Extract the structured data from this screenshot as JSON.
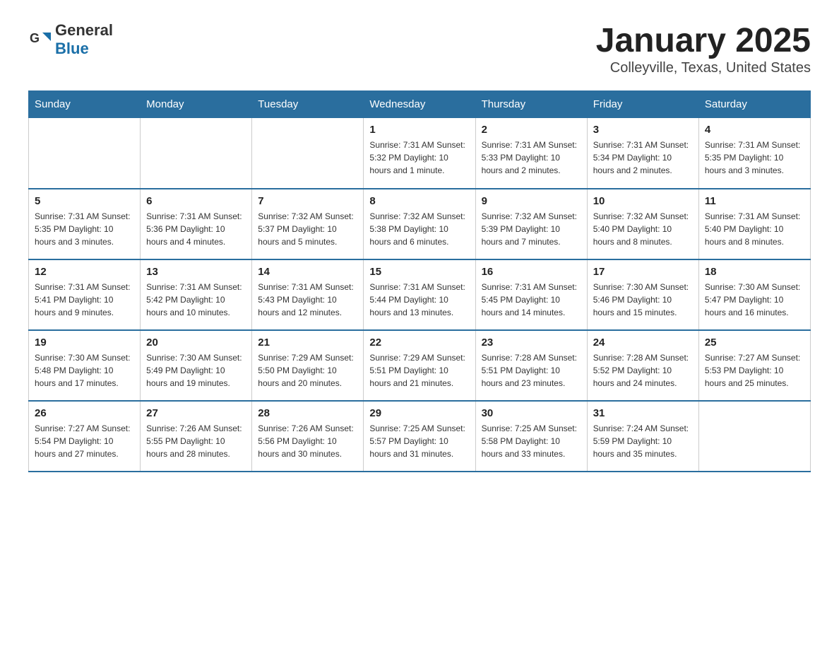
{
  "header": {
    "logo_text_general": "General",
    "logo_text_blue": "Blue",
    "title": "January 2025",
    "subtitle": "Colleyville, Texas, United States"
  },
  "days_of_week": [
    "Sunday",
    "Monday",
    "Tuesday",
    "Wednesday",
    "Thursday",
    "Friday",
    "Saturday"
  ],
  "weeks": [
    [
      {
        "day": "",
        "info": ""
      },
      {
        "day": "",
        "info": ""
      },
      {
        "day": "",
        "info": ""
      },
      {
        "day": "1",
        "info": "Sunrise: 7:31 AM\nSunset: 5:32 PM\nDaylight: 10 hours and 1 minute."
      },
      {
        "day": "2",
        "info": "Sunrise: 7:31 AM\nSunset: 5:33 PM\nDaylight: 10 hours and 2 minutes."
      },
      {
        "day": "3",
        "info": "Sunrise: 7:31 AM\nSunset: 5:34 PM\nDaylight: 10 hours and 2 minutes."
      },
      {
        "day": "4",
        "info": "Sunrise: 7:31 AM\nSunset: 5:35 PM\nDaylight: 10 hours and 3 minutes."
      }
    ],
    [
      {
        "day": "5",
        "info": "Sunrise: 7:31 AM\nSunset: 5:35 PM\nDaylight: 10 hours and 3 minutes."
      },
      {
        "day": "6",
        "info": "Sunrise: 7:31 AM\nSunset: 5:36 PM\nDaylight: 10 hours and 4 minutes."
      },
      {
        "day": "7",
        "info": "Sunrise: 7:32 AM\nSunset: 5:37 PM\nDaylight: 10 hours and 5 minutes."
      },
      {
        "day": "8",
        "info": "Sunrise: 7:32 AM\nSunset: 5:38 PM\nDaylight: 10 hours and 6 minutes."
      },
      {
        "day": "9",
        "info": "Sunrise: 7:32 AM\nSunset: 5:39 PM\nDaylight: 10 hours and 7 minutes."
      },
      {
        "day": "10",
        "info": "Sunrise: 7:32 AM\nSunset: 5:40 PM\nDaylight: 10 hours and 8 minutes."
      },
      {
        "day": "11",
        "info": "Sunrise: 7:31 AM\nSunset: 5:40 PM\nDaylight: 10 hours and 8 minutes."
      }
    ],
    [
      {
        "day": "12",
        "info": "Sunrise: 7:31 AM\nSunset: 5:41 PM\nDaylight: 10 hours and 9 minutes."
      },
      {
        "day": "13",
        "info": "Sunrise: 7:31 AM\nSunset: 5:42 PM\nDaylight: 10 hours and 10 minutes."
      },
      {
        "day": "14",
        "info": "Sunrise: 7:31 AM\nSunset: 5:43 PM\nDaylight: 10 hours and 12 minutes."
      },
      {
        "day": "15",
        "info": "Sunrise: 7:31 AM\nSunset: 5:44 PM\nDaylight: 10 hours and 13 minutes."
      },
      {
        "day": "16",
        "info": "Sunrise: 7:31 AM\nSunset: 5:45 PM\nDaylight: 10 hours and 14 minutes."
      },
      {
        "day": "17",
        "info": "Sunrise: 7:30 AM\nSunset: 5:46 PM\nDaylight: 10 hours and 15 minutes."
      },
      {
        "day": "18",
        "info": "Sunrise: 7:30 AM\nSunset: 5:47 PM\nDaylight: 10 hours and 16 minutes."
      }
    ],
    [
      {
        "day": "19",
        "info": "Sunrise: 7:30 AM\nSunset: 5:48 PM\nDaylight: 10 hours and 17 minutes."
      },
      {
        "day": "20",
        "info": "Sunrise: 7:30 AM\nSunset: 5:49 PM\nDaylight: 10 hours and 19 minutes."
      },
      {
        "day": "21",
        "info": "Sunrise: 7:29 AM\nSunset: 5:50 PM\nDaylight: 10 hours and 20 minutes."
      },
      {
        "day": "22",
        "info": "Sunrise: 7:29 AM\nSunset: 5:51 PM\nDaylight: 10 hours and 21 minutes."
      },
      {
        "day": "23",
        "info": "Sunrise: 7:28 AM\nSunset: 5:51 PM\nDaylight: 10 hours and 23 minutes."
      },
      {
        "day": "24",
        "info": "Sunrise: 7:28 AM\nSunset: 5:52 PM\nDaylight: 10 hours and 24 minutes."
      },
      {
        "day": "25",
        "info": "Sunrise: 7:27 AM\nSunset: 5:53 PM\nDaylight: 10 hours and 25 minutes."
      }
    ],
    [
      {
        "day": "26",
        "info": "Sunrise: 7:27 AM\nSunset: 5:54 PM\nDaylight: 10 hours and 27 minutes."
      },
      {
        "day": "27",
        "info": "Sunrise: 7:26 AM\nSunset: 5:55 PM\nDaylight: 10 hours and 28 minutes."
      },
      {
        "day": "28",
        "info": "Sunrise: 7:26 AM\nSunset: 5:56 PM\nDaylight: 10 hours and 30 minutes."
      },
      {
        "day": "29",
        "info": "Sunrise: 7:25 AM\nSunset: 5:57 PM\nDaylight: 10 hours and 31 minutes."
      },
      {
        "day": "30",
        "info": "Sunrise: 7:25 AM\nSunset: 5:58 PM\nDaylight: 10 hours and 33 minutes."
      },
      {
        "day": "31",
        "info": "Sunrise: 7:24 AM\nSunset: 5:59 PM\nDaylight: 10 hours and 35 minutes."
      },
      {
        "day": "",
        "info": ""
      }
    ]
  ]
}
